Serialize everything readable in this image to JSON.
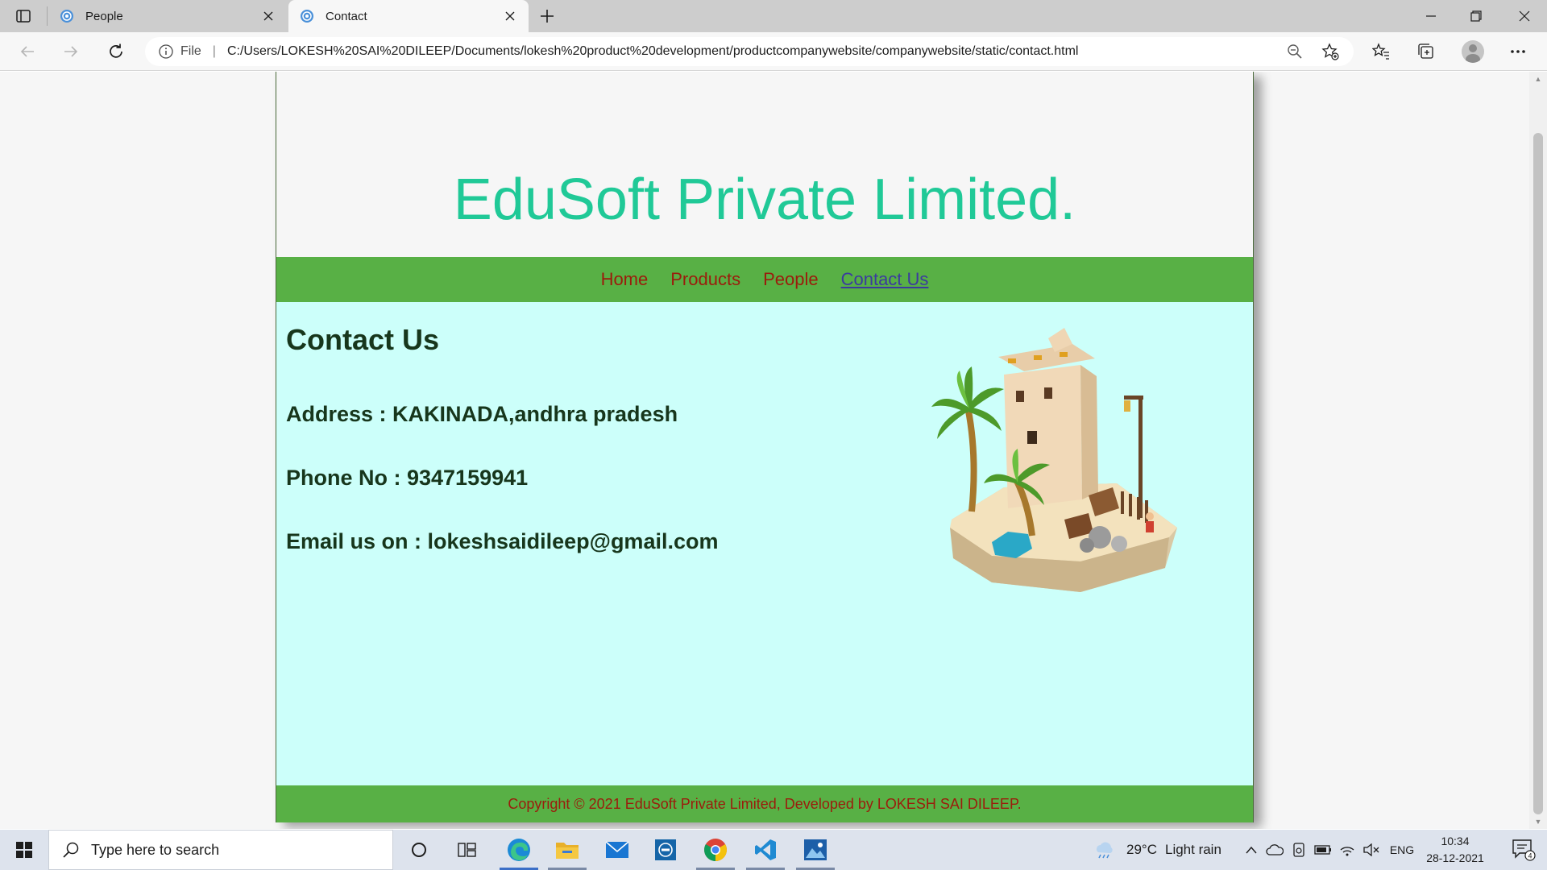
{
  "browser": {
    "tabs": [
      {
        "title": "People",
        "active": false
      },
      {
        "title": "Contact",
        "active": true
      }
    ],
    "address_bar": {
      "scheme_label": "File",
      "url": "C:/Users/LOKESH%20SAI%20DILEEP/Documents/lokesh%20product%20development/productcompanywebsite/companywebsite/static/contact.html"
    }
  },
  "site": {
    "title": "EduSoft Private Limited.",
    "nav": [
      {
        "label": "Home",
        "current": false
      },
      {
        "label": "Products",
        "current": false
      },
      {
        "label": "People",
        "current": false
      },
      {
        "label": "Contact Us",
        "current": true
      }
    ],
    "heading": "Contact Us",
    "address": "Address : KAKINADA,andhra pradesh",
    "phone": "Phone No : 9347159941",
    "email": "Email us on : lokeshsaidileep@gmail.com",
    "footer": "Copyright © 2021 EduSoft Private Limited, Developed by LOKESH SAI DILEEP.",
    "colors": {
      "title": "#20c997",
      "nav_bg": "#58b045",
      "nav_link": "#9b1c0c",
      "nav_current": "#3b3b9e",
      "main_bg": "#ccfffa",
      "text": "#17361c"
    }
  },
  "taskbar": {
    "search_placeholder": "Type here to search",
    "weather": {
      "temp": "29°C",
      "condition": "Light rain"
    },
    "language": "ENG",
    "time": "10:34",
    "date": "28-12-2021",
    "notification_count": "4",
    "apps": [
      "edge-icon",
      "file-explorer-icon",
      "mail-icon",
      "dell-icon",
      "chrome-icon",
      "vscode-icon",
      "photos-icon"
    ]
  }
}
